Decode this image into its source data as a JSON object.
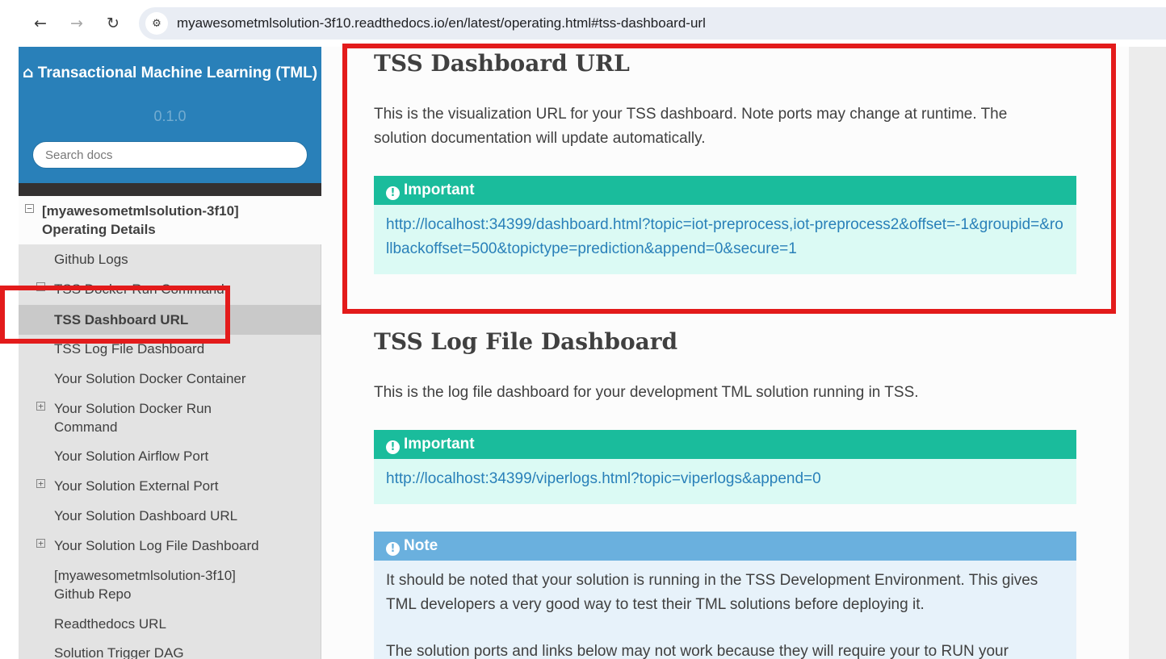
{
  "browser": {
    "url": "myawesometmlsolution-3f10.readthedocs.io/en/latest/operating.html#tss-dashboard-url",
    "back_icon": "←",
    "forward_icon": "→",
    "reload_icon": "↻",
    "site_info_icon": "⚙"
  },
  "sidebar": {
    "project_title": "Transactional Machine Learning (TML)",
    "home_icon": "⌂",
    "version": "0.1.0",
    "search_placeholder": "Search docs",
    "toc_parent": {
      "toggle": "−",
      "label": "[myawesometmlsolution-3f10] Operating Details"
    },
    "items": [
      {
        "label": "Github Logs",
        "toggle": ""
      },
      {
        "label": "TSS Docker Run Command",
        "toggle": "−"
      },
      {
        "label": "TSS Dashboard URL",
        "toggle": "",
        "current": true
      },
      {
        "label": "TSS Log File Dashboard",
        "toggle": ""
      },
      {
        "label": "Your Solution Docker Container",
        "toggle": ""
      },
      {
        "label": "Your Solution Docker Run Command",
        "toggle": "+"
      },
      {
        "label": "Your Solution Airflow Port",
        "toggle": ""
      },
      {
        "label": "Your Solution External Port",
        "toggle": "+"
      },
      {
        "label": "Your Solution Dashboard URL",
        "toggle": ""
      },
      {
        "label": "Your Solution Log File Dashboard",
        "toggle": "+"
      },
      {
        "label": "[myawesometmlsolution-3f10] Github Repo",
        "toggle": ""
      },
      {
        "label": "Readthedocs URL",
        "toggle": ""
      },
      {
        "label": "Solution Trigger DAG",
        "toggle": ""
      }
    ]
  },
  "main": {
    "section1": {
      "heading": "TSS Dashboard URL",
      "paragraph": "This is the visualization URL for your TSS dashboard. Note ports may change at runtime. The solution documentation will update automatically.",
      "admonition_title": "Important",
      "link": "http://localhost:34399/dashboard.html?topic=iot-preprocess,iot-preprocess2&offset=-1&groupid=&rollbackoffset=500&topictype=prediction&append=0&secure=1"
    },
    "section2": {
      "heading": "TSS Log File Dashboard",
      "paragraph": "This is the log file dashboard for your development TML solution running in TSS.",
      "admonition_title": "Important",
      "link": "http://localhost:34399/viperlogs.html?topic=viperlogs&append=0"
    },
    "note": {
      "title": "Note",
      "paragraph1": "It should be noted that your solution is running in the TSS Development Environment. This gives TML developers a very good way to test their TML solutions before deploying it.",
      "paragraph2": "The solution ports and links below may not work because they will require your to RUN your"
    },
    "admonition_icon": "!",
    "colors": {
      "important": "#1abc9c",
      "note": "#6ab0de",
      "link": "#2980b9",
      "annotation": "#e31b1b"
    }
  }
}
